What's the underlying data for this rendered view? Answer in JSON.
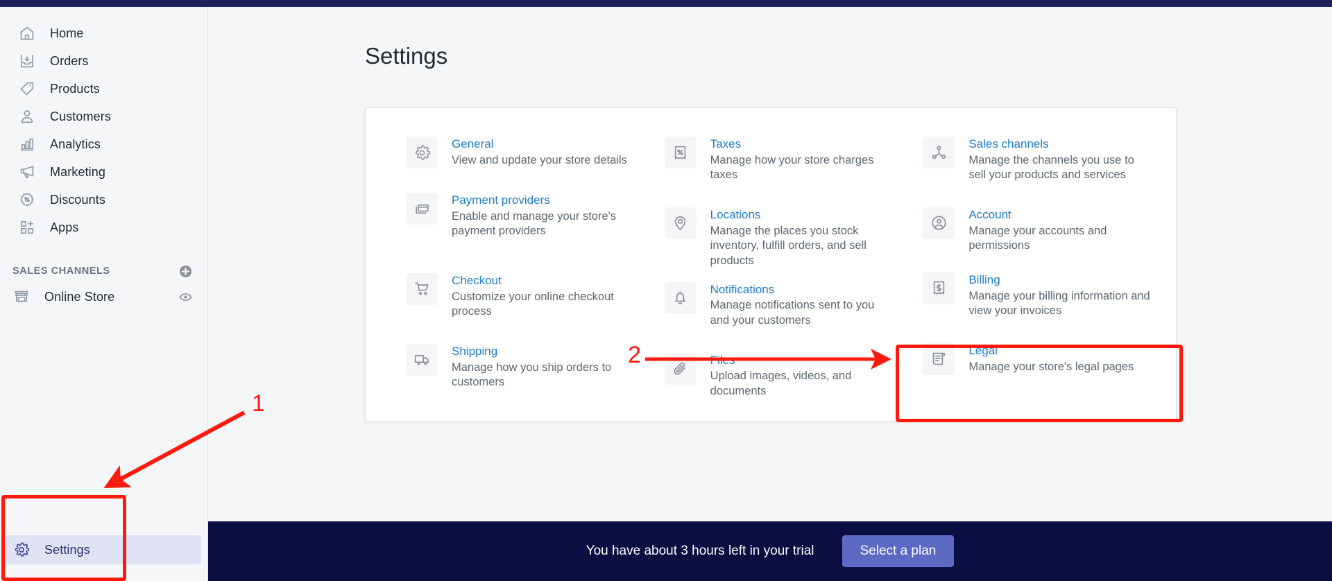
{
  "sidebar": {
    "nav": [
      {
        "label": "Home",
        "icon": "home-icon"
      },
      {
        "label": "Orders",
        "icon": "orders-inbox-icon"
      },
      {
        "label": "Products",
        "icon": "product-tag-icon"
      },
      {
        "label": "Customers",
        "icon": "customer-person-icon"
      },
      {
        "label": "Analytics",
        "icon": "analytics-bars-icon"
      },
      {
        "label": "Marketing",
        "icon": "marketing-megaphone-icon"
      },
      {
        "label": "Discounts",
        "icon": "discount-badge-percent-icon"
      },
      {
        "label": "Apps",
        "icon": "apps-grid-plus-icon"
      }
    ],
    "sales_channels": {
      "title": "SALES CHANNELS",
      "add_icon": "plus-circle-icon",
      "items": [
        {
          "label": "Online Store",
          "icon": "storefront-icon",
          "trailing_icon": "eye-icon"
        }
      ]
    },
    "settings": {
      "label": "Settings",
      "icon": "gear-icon",
      "selected": true
    }
  },
  "main": {
    "title": "Settings",
    "columns": [
      {
        "items": [
          {
            "title": "General",
            "desc": "View and update your store details",
            "icon": "gear-icon"
          },
          {
            "title": "Payment providers",
            "desc": "Enable and manage your store's payment providers",
            "icon": "payment-card-icon"
          },
          {
            "title": "Checkout",
            "desc": "Customize your online checkout process",
            "icon": "cart-icon"
          },
          {
            "title": "Shipping",
            "desc": "Manage how you ship orders to customers",
            "icon": "truck-icon"
          }
        ]
      },
      {
        "items": [
          {
            "title": "Taxes",
            "desc": "Manage how your store charges taxes",
            "icon": "receipt-percent-icon"
          },
          {
            "title": "Locations",
            "desc": "Manage the places you stock inventory, fulfill orders, and sell products",
            "icon": "location-pin-icon"
          },
          {
            "title": "Notifications",
            "desc": "Manage notifications sent to you and your customers",
            "icon": "bell-icon"
          },
          {
            "title": "Files",
            "desc": "Upload images, videos, and documents",
            "icon": "paperclip-icon"
          }
        ]
      },
      {
        "items": [
          {
            "title": "Sales channels",
            "desc": "Manage the channels you use to sell your products and services",
            "icon": "network-nodes-icon"
          },
          {
            "title": "Account",
            "desc": "Manage your accounts and permissions",
            "icon": "account-circle-icon"
          },
          {
            "title": "Billing",
            "desc": "Manage your billing information and view your invoices",
            "icon": "receipt-dollar-icon"
          },
          {
            "title": "Legal",
            "desc": "Manage your store's legal pages",
            "icon": "legal-scroll-icon"
          }
        ]
      }
    ]
  },
  "banner": {
    "text": "You have about 3 hours left in your trial",
    "button": "Select a plan"
  },
  "annotations": {
    "step_one": "1",
    "step_two": "2",
    "color": "#ff1a0d"
  },
  "colors": {
    "link_blue": "#1f7bc4",
    "sidebar_bg": "#f4f6f8",
    "banner_bg": "#0b0e41",
    "plan_button": "#5c6ac4",
    "selected_nav": "#dfe3f3",
    "topbar": "#1f2259"
  }
}
